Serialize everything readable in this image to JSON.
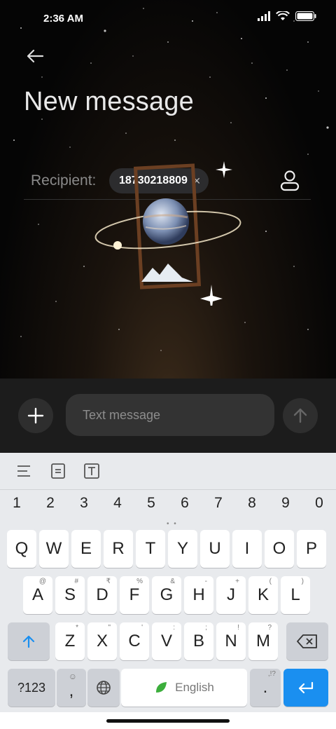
{
  "status_bar": {
    "time": "2:36 AM"
  },
  "header": {
    "title": "New message"
  },
  "recipient": {
    "label": "Recipient:",
    "chip": "18730218809",
    "chip_remove": "×"
  },
  "compose": {
    "placeholder": "Text message"
  },
  "keyboard": {
    "numbers": [
      "1",
      "2",
      "3",
      "4",
      "5",
      "6",
      "7",
      "8",
      "9",
      "0"
    ],
    "row1": [
      "Q",
      "W",
      "E",
      "R",
      "T",
      "Y",
      "U",
      "I",
      "O",
      "P"
    ],
    "row2": [
      "A",
      "S",
      "D",
      "F",
      "G",
      "H",
      "J",
      "K",
      "L"
    ],
    "row2_hints": [
      "@",
      "#",
      "₹",
      "%",
      "&",
      "-",
      "+",
      "(",
      ")"
    ],
    "row3": [
      "Z",
      "X",
      "C",
      "V",
      "B",
      "N",
      "M"
    ],
    "row3_hints": [
      "*",
      "\"",
      "'",
      ":",
      ";",
      "!",
      "?"
    ],
    "sym_label": "?123",
    "emoji_comma": ",",
    "space_label": "English",
    "period": ".",
    "period_hint": ",!?"
  },
  "colors": {
    "accent_blue": "#1a8ff0",
    "compose_bg": "#1c1c1c",
    "keyboard_bg": "#e8eaed"
  }
}
